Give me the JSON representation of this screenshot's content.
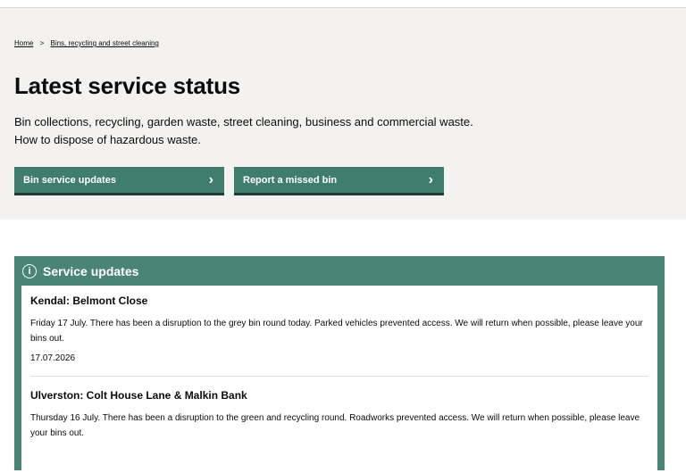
{
  "breadcrumb": {
    "home": "Home",
    "separator": ">",
    "current": "Bins, recycling and street cleaning"
  },
  "page": {
    "title": "Latest service status",
    "intro_line1": "Bin collections, recycling, garden waste, street cleaning, business and commercial waste.",
    "intro_line2": "How to dispose of hazardous waste."
  },
  "buttons": {
    "bin_updates": "Bin service updates",
    "missed_bin": "Report a missed bin",
    "chevron": "›"
  },
  "panel": {
    "icon": "i",
    "title": "Service updates",
    "updates": [
      {
        "heading": "Kendal: Belmont Close",
        "body": "Friday 17 July. There has been a disruption to the grey bin round today. Parked vehicles prevented access. We will return when possible, please leave your bins out.",
        "date": "17.07.2026"
      },
      {
        "heading": "Ulverston: Colt House Lane & Malkin Bank",
        "body": "Thursday 16 July. There has been a disruption to the green and recycling round. Roadworks prevented access. We will return when possible, please leave your bins out.",
        "date": ""
      }
    ]
  },
  "colors": {
    "primary": "#3f7d6e",
    "panel": "#4a8377",
    "hero_bg": "#f3f2f1"
  }
}
